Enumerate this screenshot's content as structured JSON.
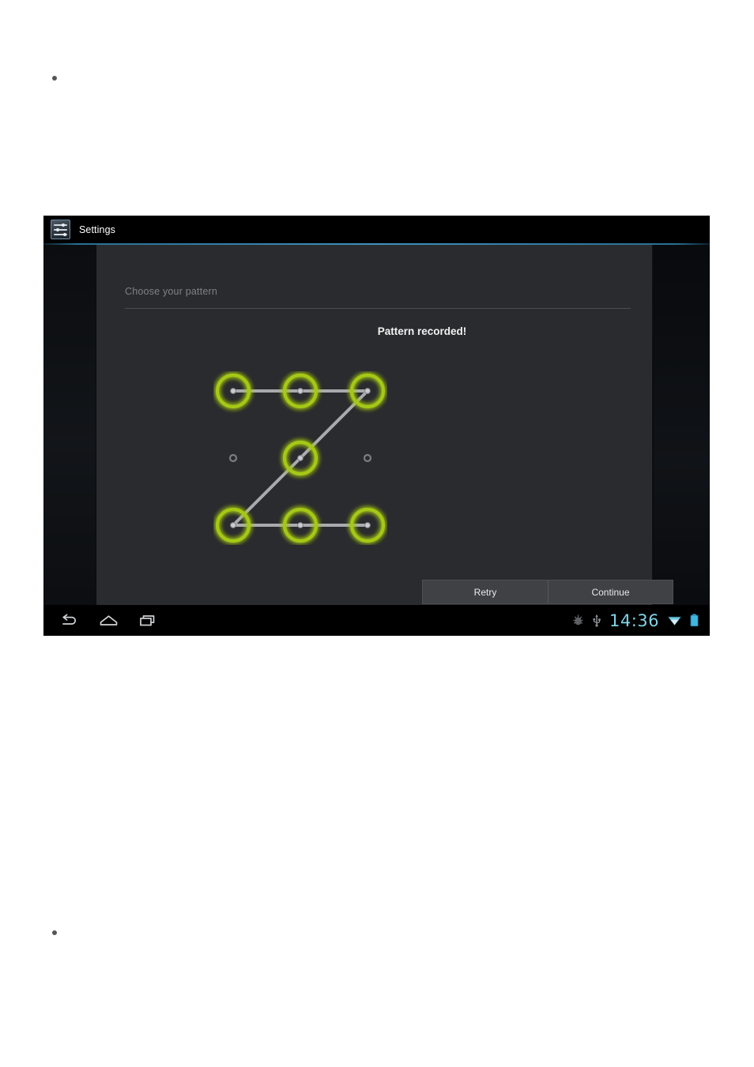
{
  "document": {
    "background_color": "#ffffff",
    "bullets": [
      {
        "name": "bullet-top",
        "text": ""
      },
      {
        "name": "bullet-bottom",
        "text": ""
      }
    ]
  },
  "screenshot": {
    "titlebar": {
      "app_icon": "settings-sliders-icon",
      "title": "Settings",
      "background_color": "#000000",
      "accent_color": "#3d92bd"
    },
    "panel": {
      "header": "Choose your pattern",
      "status_message": "Pattern recorded!",
      "background_color": "#2a2b2e"
    },
    "pattern": {
      "lit_color": "#a5c818",
      "line_color": "#b9bcc0",
      "unlit_dot_color": "#6c6e72",
      "grid": [
        {
          "row": 0,
          "col": 0,
          "lit": true
        },
        {
          "row": 0,
          "col": 1,
          "lit": true
        },
        {
          "row": 0,
          "col": 2,
          "lit": true
        },
        {
          "row": 1,
          "col": 0,
          "lit": false
        },
        {
          "row": 1,
          "col": 1,
          "lit": true
        },
        {
          "row": 1,
          "col": 2,
          "lit": false
        },
        {
          "row": 2,
          "col": 0,
          "lit": true
        },
        {
          "row": 2,
          "col": 1,
          "lit": true
        },
        {
          "row": 2,
          "col": 2,
          "lit": true
        }
      ],
      "path_sequence": [
        1,
        2,
        3,
        5,
        7,
        8,
        9
      ],
      "shape_description": "Z"
    },
    "buttons": {
      "retry_label": "Retry",
      "continue_label": "Continue"
    },
    "navbar": {
      "back_icon": "back-arrow-icon",
      "home_icon": "home-icon",
      "recents_icon": "recent-apps-icon",
      "status_icons": [
        "android-debug-icon",
        "usb-icon"
      ],
      "clock": "14:36",
      "clock_color": "#7fd4e8",
      "wifi_icon": "wifi-icon",
      "battery_icon": "battery-icon",
      "battery_color": "#3fb8e0"
    }
  }
}
